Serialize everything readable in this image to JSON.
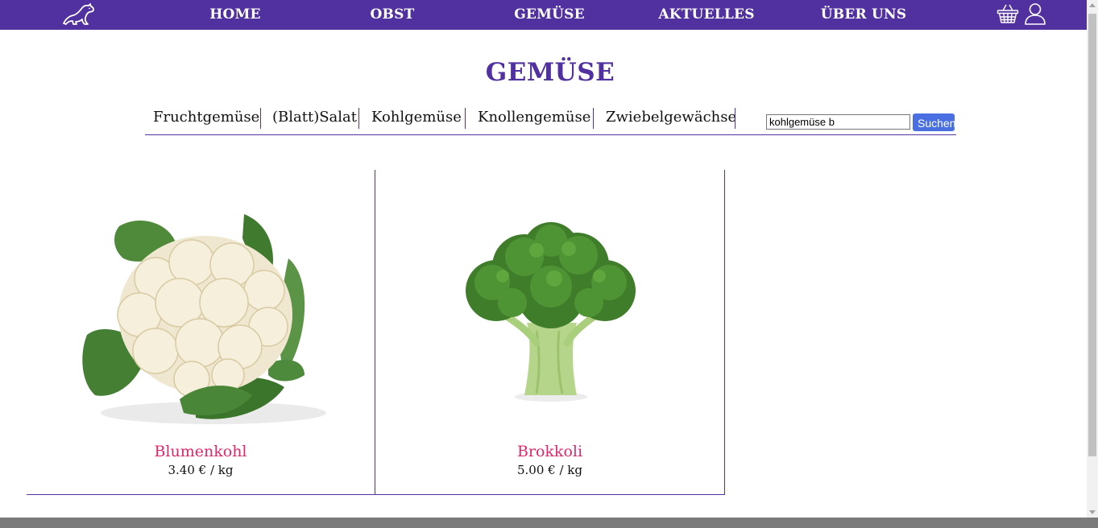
{
  "nav": {
    "items": [
      {
        "label": "HOME"
      },
      {
        "label": "OBST"
      },
      {
        "label": "GEMÜSE"
      },
      {
        "label": "AKTUELLES"
      },
      {
        "label": "ÜBER UNS"
      }
    ],
    "logo_icon": "ferret-logo-icon",
    "cart_icon": "basket-icon",
    "user_icon": "user-icon"
  },
  "page": {
    "title": "GEMÜSE"
  },
  "categories": [
    {
      "label": "Fruchtgemüse"
    },
    {
      "label": "(Blatt)Salat"
    },
    {
      "label": "Kohlgemüse"
    },
    {
      "label": "Knollengemüse"
    },
    {
      "label": "Zwiebelgewächse"
    }
  ],
  "search": {
    "value": "kohlgemüse b",
    "button_label": "Suchen"
  },
  "products": [
    {
      "name": "Blumenkohl",
      "price": "3.40 € / kg"
    },
    {
      "name": "Brokkoli",
      "price": "5.00 € / kg"
    }
  ],
  "colors": {
    "brand": "#51309f",
    "product_name": "#e0276c",
    "search_button": "#4a6fe3"
  }
}
